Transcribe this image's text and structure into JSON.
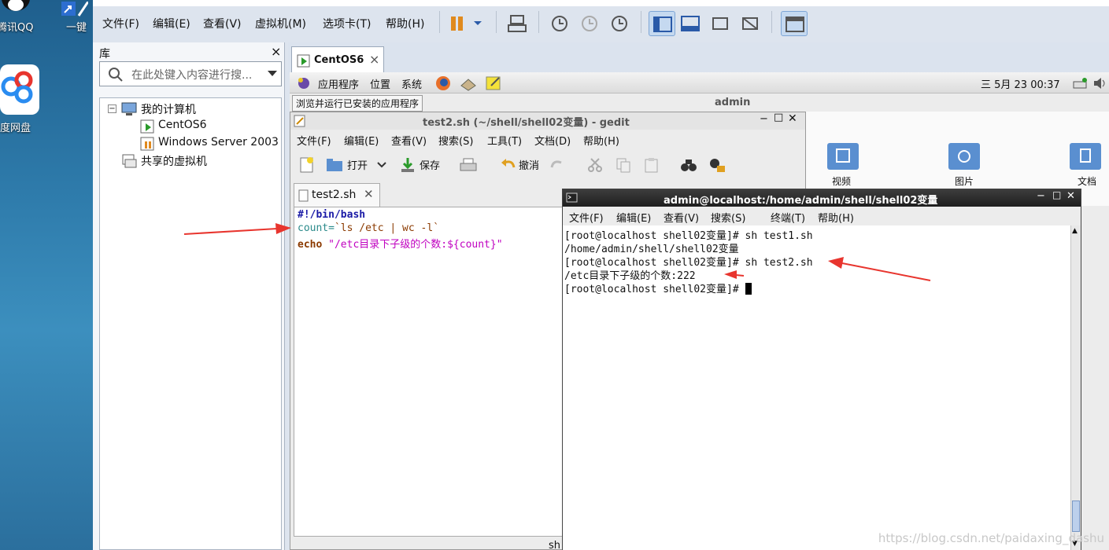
{
  "desktop": {
    "icons": [
      {
        "label": "腾讯QQ",
        "icon": "qq-icon"
      },
      {
        "label": "一键",
        "icon": "shortcut-icon"
      },
      {
        "label": "度网盘",
        "icon": "baidu-netdisk-icon"
      }
    ]
  },
  "vmware": {
    "menu": [
      "文件(F)",
      "编辑(E)",
      "查看(V)",
      "虚拟机(M)",
      "选项卡(T)",
      "帮助(H)"
    ],
    "library": {
      "title": "库",
      "close": "×",
      "search_placeholder": "在此处键入内容进行搜...",
      "tree": {
        "root": "我的计算机",
        "vms": [
          "CentOS6",
          "Windows Server 2003"
        ],
        "shared": "共享的虚拟机"
      }
    },
    "vm_tab": {
      "label": "CentOS6",
      "close": "×"
    }
  },
  "guest": {
    "panel": {
      "menus": [
        "应用程序",
        "位置",
        "系统"
      ],
      "clock": "三 5月 23 00:37",
      "user": "admin"
    },
    "tooltip": "浏览并运行已安装的应用程序",
    "gedit": {
      "title": "test2.sh (~/shell/shell02变量) - gedit",
      "menu": [
        "文件(F)",
        "编辑(E)",
        "查看(V)",
        "搜索(S)",
        "工具(T)",
        "文档(D)",
        "帮助(H)"
      ],
      "toolbar": {
        "open": "打开",
        "save": "保存",
        "undo": "撤消"
      },
      "tab": "test2.sh",
      "code": {
        "line1": "#!/bin/bash",
        "line2_var": "count=",
        "line2_cmd": "`ls /etc | wc -l`",
        "line3_kw": "echo",
        "line3_str": " \"/etc目录下子级的个数:${count}\""
      },
      "status_fragment": "sh"
    },
    "file_manager": {
      "folders": [
        "视频",
        "图片",
        "文档"
      ]
    },
    "terminal": {
      "title": "admin@localhost:/home/admin/shell/shell02变量",
      "menu": [
        "文件(F)",
        "编辑(E)",
        "查看(V)",
        "搜索(S)",
        "终端(T)",
        "帮助(H)"
      ],
      "lines": [
        "[root@localhost shell02变量]# sh test1.sh",
        "/home/admin/shell/shell02变量",
        "[root@localhost shell02变量]# sh test2.sh",
        "/etc目录下子级的个数:222",
        "[root@localhost shell02变量]# "
      ]
    }
  },
  "watermark": "https://blog.csdn.net/paidaxing_dashu",
  "colors": {
    "annotation_arrow": "#e8352e",
    "keyword_blue": "#1a1aa6",
    "string_magenta": "#c000c0",
    "command_brown": "#8b3a00"
  }
}
